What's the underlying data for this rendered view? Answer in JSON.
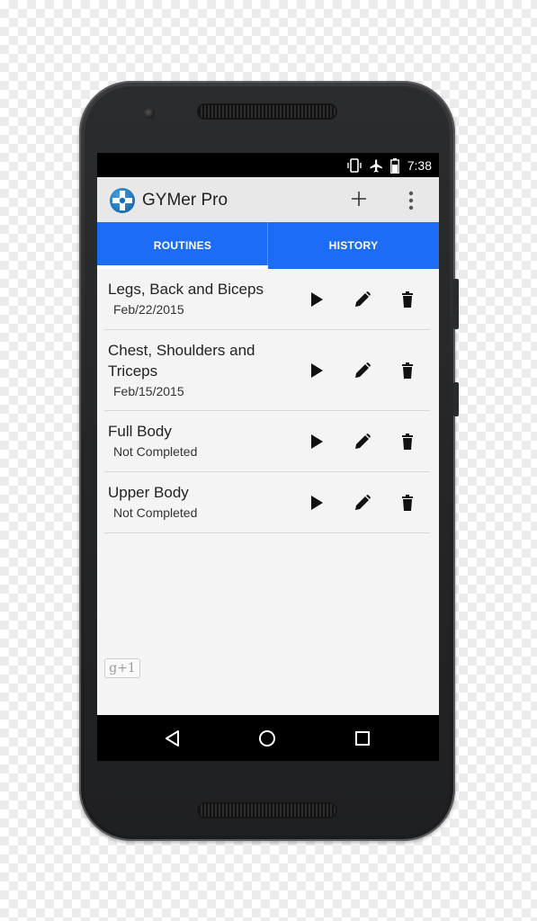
{
  "status_bar": {
    "time": "7:38",
    "icons": [
      "vibrate-icon",
      "airplane-icon",
      "battery-icon"
    ]
  },
  "app_bar": {
    "title": "GYMer Pro",
    "logo_icon": "app-logo-icon",
    "actions": [
      "plus-icon",
      "overflow-menu-icon"
    ]
  },
  "tabs": [
    {
      "label": "ROUTINES",
      "active": true
    },
    {
      "label": "HISTORY",
      "active": false
    }
  ],
  "routines": [
    {
      "title": "Legs, Back and Biceps",
      "subtitle": "Feb/22/2015"
    },
    {
      "title": "Chest, Shoulders and Triceps",
      "subtitle": "Feb/15/2015"
    },
    {
      "title": "Full Body",
      "subtitle": "Not Completed"
    },
    {
      "title": "Upper Body",
      "subtitle": "Not Completed"
    }
  ],
  "row_actions": [
    "play-icon",
    "edit-pencil-icon",
    "delete-trash-icon"
  ],
  "gplus": {
    "label": "g+1"
  },
  "nav_bar": [
    "back-icon",
    "home-icon",
    "recents-icon"
  ],
  "colors": {
    "accent": "#1d6cf5",
    "appbar": "#e8e8e8",
    "content_bg": "#f4f4f4"
  }
}
